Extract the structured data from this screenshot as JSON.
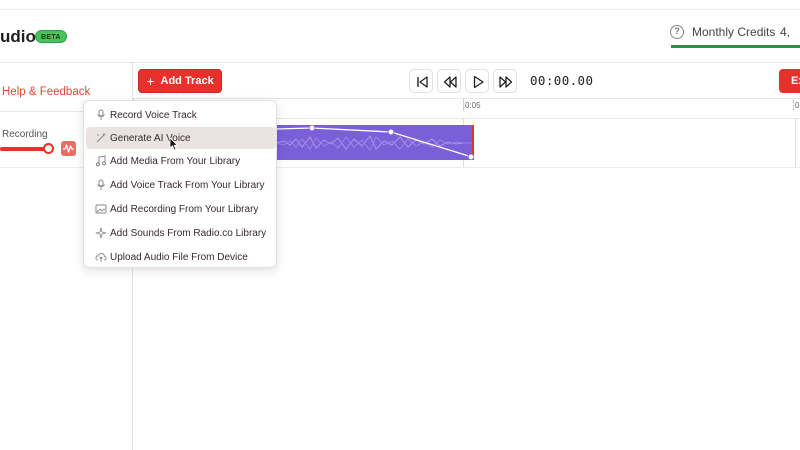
{
  "header": {
    "app_title": "udio",
    "beta_badge": "BETA",
    "credits_label": "Monthly Credits",
    "credits_value": "4,",
    "credits_bar_color": "#2f8f47",
    "help_icon": "question-circle-icon"
  },
  "sidebar": {
    "help_link": "Help & Feedback",
    "track": {
      "name": "Recording",
      "volume_fraction": 1.0,
      "wave_icon": "waveform-icon"
    }
  },
  "toolbar": {
    "add_track_label": "Add Track",
    "add_track_icon": "plus-icon",
    "buttons": [
      {
        "name": "skip-to-start-icon"
      },
      {
        "name": "rewind-icon"
      },
      {
        "name": "play-icon"
      },
      {
        "name": "fast-forward-icon"
      }
    ],
    "time": "00:00.00",
    "export_label": "Ex",
    "accent_color": "#e8312a"
  },
  "timeline": {
    "ticks": [
      "0:05",
      "0"
    ],
    "clip_color": "#7b5fd8"
  },
  "add_track_menu": {
    "items": [
      {
        "label": "Record Voice Track",
        "icon": "microphone-icon",
        "active": false
      },
      {
        "label": "Generate AI Voice",
        "icon": "magic-wand-icon",
        "active": true
      },
      {
        "label": "Add Media From Your Library",
        "icon": "music-note-icon",
        "active": false
      },
      {
        "label": "Add Voice Track From Your Library",
        "icon": "microphone-icon",
        "active": false
      },
      {
        "label": "Add Recording From Your Library",
        "icon": "image-icon",
        "active": false
      },
      {
        "label": "Add Sounds From Radio.co Library",
        "icon": "sparkle-icon",
        "active": false
      },
      {
        "label": "Upload Audio File From Device",
        "icon": "cloud-upload-icon",
        "active": false
      }
    ]
  }
}
